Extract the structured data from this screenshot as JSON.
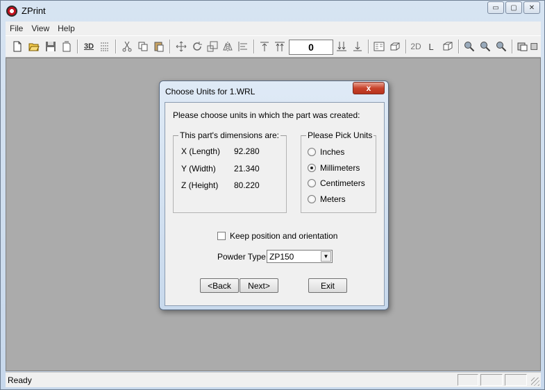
{
  "app": {
    "title": "ZPrint"
  },
  "window_controls": {
    "minimize": "▭",
    "maximize": "▢",
    "close": "✕"
  },
  "menu": [
    "File",
    "View",
    "Help"
  ],
  "toolbar": {
    "layer_value": "0",
    "icons": [
      "new-icon",
      "open-icon",
      "save-icon",
      "export-icon",
      "3d-view-icon",
      "settings-icon",
      "cut-icon",
      "copy-icon",
      "paste-icon",
      "move-icon",
      "rotate-icon",
      "scale-icon",
      "mirror-icon",
      "align-icon",
      "top-icon",
      "top-top-icon",
      "bottom-bottom-icon",
      "bottom-icon",
      "page-icon",
      "box-icon",
      "2d-icon",
      "l-icon",
      "cube-icon",
      "zoom-in-icon",
      "zoom-out-icon",
      "zoom-fit-icon",
      "view-icon",
      "view2-icon"
    ],
    "labels": {
      "threeD": "3D",
      "twoD": "2D",
      "L": "L"
    }
  },
  "status": {
    "text": "Ready"
  },
  "dialog": {
    "title": "Choose Units for 1.WRL",
    "close_label": "x",
    "prompt": "Please choose units in which the part was created:",
    "dimensions": {
      "title": "This part's dimensions are:",
      "rows": [
        {
          "label": "X (Length)",
          "value": "92.280"
        },
        {
          "label": "Y (Width)",
          "value": "21.340"
        },
        {
          "label": "Z (Height)",
          "value": "80.220"
        }
      ]
    },
    "units": {
      "title": "Please Pick Units",
      "options": [
        "Inches",
        "Millimeters",
        "Centimeters",
        "Meters"
      ],
      "selected": "Millimeters"
    },
    "keep_position_label": "Keep position and orientation",
    "keep_position_checked": false,
    "powder_type_label": "Powder Type",
    "powder_type_value": "ZP150",
    "buttons": {
      "back": "<Back",
      "next": "Next>",
      "exit": "Exit"
    }
  }
}
